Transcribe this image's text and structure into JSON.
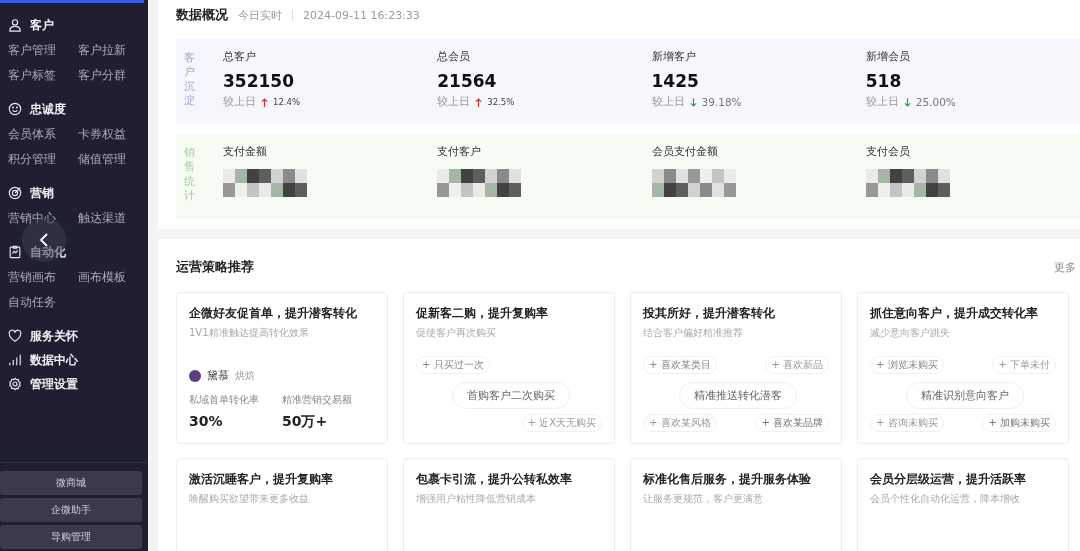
{
  "sidebar": {
    "groups": [
      {
        "title": "客户",
        "items": [
          "客户管理",
          "客户拉新",
          "客户标签",
          "客户分群"
        ]
      },
      {
        "title": "忠诚度",
        "items": [
          "会员体系",
          "卡券权益",
          "积分管理",
          "储值管理"
        ]
      },
      {
        "title": "营销",
        "items": [
          "营销中心",
          "触达渠道"
        ]
      },
      {
        "title": "自动化",
        "items": [
          "营销画布",
          "画布模板",
          "自动任务"
        ]
      },
      {
        "title": "服务关怀"
      },
      {
        "title": "数据中心"
      },
      {
        "title": "管理设置"
      }
    ],
    "buttons": [
      "微商城",
      "企微助手",
      "导购管理"
    ]
  },
  "overview": {
    "title": "数据概况",
    "realtime": "今日实时",
    "time": "2024-09-11 16:23:33",
    "sections": [
      {
        "label": "客户沉淀",
        "metrics": [
          {
            "name": "总客户",
            "value": "352150",
            "compare": "较上日",
            "rising": true,
            "change": "12.4%"
          },
          {
            "name": "总会员",
            "value": "21564",
            "compare": "较上日",
            "rising": true,
            "change": "32.5%"
          },
          {
            "name": "新增客户",
            "value": "1425",
            "compare": "较上日",
            "rising": false,
            "change": "39.18%"
          },
          {
            "name": "新增会员",
            "value": "518",
            "compare": "较上日",
            "rising": false,
            "change": "25.00%"
          }
        ]
      },
      {
        "label": "销售统计",
        "metrics": [
          {
            "name": "支付金额"
          },
          {
            "name": "支付客户"
          },
          {
            "name": "会员支付金额"
          },
          {
            "name": "支付会员"
          }
        ]
      }
    ]
  },
  "strategies": {
    "title": "运营策略推荐",
    "more": "更多",
    "cards": [
      {
        "kind": "stats",
        "title": "企微好友促首单，提升潜客转化",
        "subtitle": "1V1精准触达提高转化效果",
        "brand": "黛慕",
        "category": "烘焙",
        "stats": [
          {
            "label": "私域首单转化率",
            "value": "30%"
          },
          {
            "label": "精准营销交易额",
            "value": "50万+"
          }
        ]
      },
      {
        "kind": "tags",
        "title": "促新客二购，提升复购率",
        "subtitle": "促使客户再次购买",
        "center": "首购客户二次购买",
        "tags": [
          "+ 只买过一次",
          "+ 近X天无购买"
        ]
      },
      {
        "kind": "tags",
        "title": "投其所好，提升潜客转化",
        "subtitle": "结合客户偏好精准推荐",
        "center": "精准推送转化潜客",
        "tags": [
          "+ 喜欢某类目",
          "+ 喜欢新品",
          "+ 喜欢某风格",
          "+ 喜欢某品牌"
        ]
      },
      {
        "kind": "tags",
        "title": "抓住意向客户，提升成交转化率",
        "subtitle": "减少意向客户跳失",
        "center": "精准识别意向客户",
        "tags": [
          "+ 浏览未购买",
          "+ 下单未付",
          "+ 咨询未购买",
          "+ 加购未购买"
        ]
      },
      {
        "kind": "plain",
        "title": "激活沉睡客户，提升复购率",
        "subtitle": "唤醒购买欲望带来更多收益"
      },
      {
        "kind": "plain",
        "title": "包裹卡引流，提升公转私效率",
        "subtitle": "增强用户粘性降低营销成本"
      },
      {
        "kind": "plain",
        "title": "标准化售后服务，提升服务体验",
        "subtitle": "让服务更规范，客户更满意"
      },
      {
        "kind": "plain",
        "title": "会员分层级运营，提升活跃率",
        "subtitle": "会员个性化自动化运营，降本增收"
      }
    ]
  }
}
